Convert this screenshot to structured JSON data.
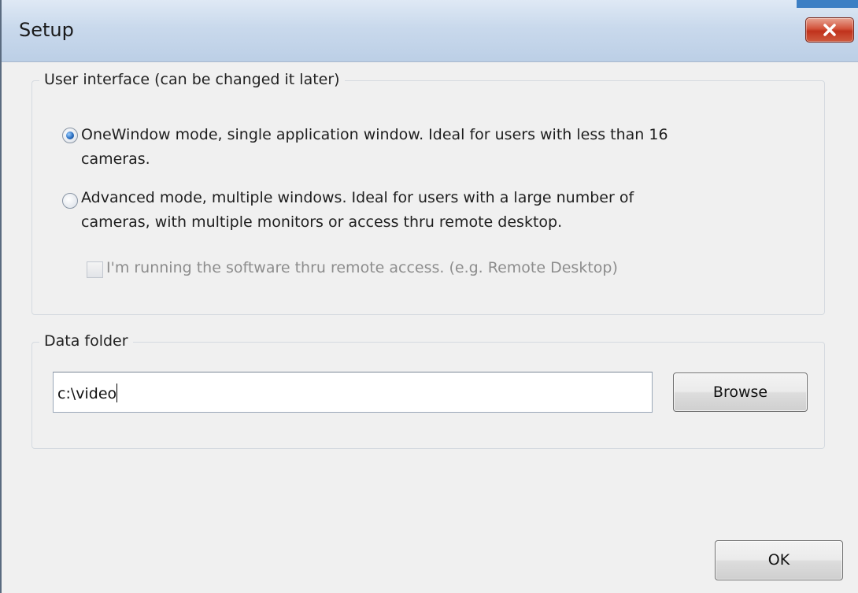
{
  "window": {
    "title": "Setup"
  },
  "user_interface": {
    "legend": "User interface (can be changed it later)",
    "options": [
      {
        "line1": "OneWindow mode, single application window. Ideal for users with less than 16",
        "line2": "cameras.",
        "selected": true
      },
      {
        "line1": "Advanced mode, multiple windows. Ideal for users with a large number of",
        "line2": "cameras, with multiple monitors or access thru remote desktop.",
        "selected": false
      }
    ],
    "remote_checkbox": {
      "label": "I'm running the software thru remote access. (e.g. Remote Desktop)",
      "checked": false,
      "enabled": false
    }
  },
  "data_folder": {
    "legend": "Data folder",
    "value": "c:\\video",
    "browse_label": "Browse"
  },
  "footer": {
    "ok_label": "OK"
  },
  "colors": {
    "title_bar": "#c9d9ec",
    "close_button": "#c0321c",
    "window_bg": "#f0f0f0",
    "disabled_text": "#8d8d8d"
  },
  "icons": {
    "close": "close-x-icon"
  }
}
